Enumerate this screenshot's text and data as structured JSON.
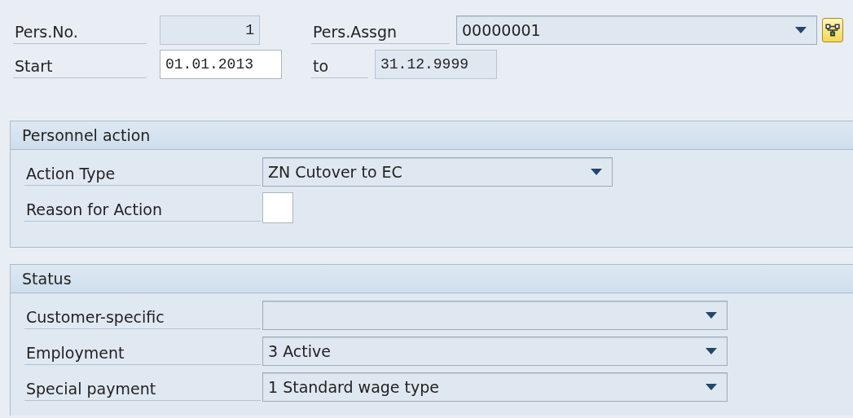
{
  "header": {
    "rows": [
      {
        "fields": [
          {
            "label": "Pers.No.",
            "kind": "readonly",
            "value": "1"
          },
          {
            "label": "Pers.Assgn",
            "kind": "dropdown",
            "value": "00000001",
            "button": true
          }
        ]
      },
      {
        "fields": [
          {
            "label": "Start",
            "kind": "input",
            "value": "01.01.2013"
          },
          {
            "label": "to",
            "kind": "readonly",
            "value": "31.12.9999"
          }
        ]
      }
    ]
  },
  "sections": [
    {
      "title": "Personnel action",
      "rows": [
        {
          "label": "Action Type",
          "kind": "dropdown",
          "value": "ZN Cutover to EC"
        },
        {
          "label": "Reason for Action",
          "kind": "input",
          "value": ""
        }
      ]
    },
    {
      "title": "Status",
      "rows": [
        {
          "label": "Customer-specific",
          "kind": "dropdown",
          "value": ""
        },
        {
          "label": "Employment",
          "kind": "dropdown",
          "value": "3 Active"
        },
        {
          "label": "Special payment",
          "kind": "dropdown",
          "value": "1 Standard wage type"
        }
      ]
    }
  ]
}
